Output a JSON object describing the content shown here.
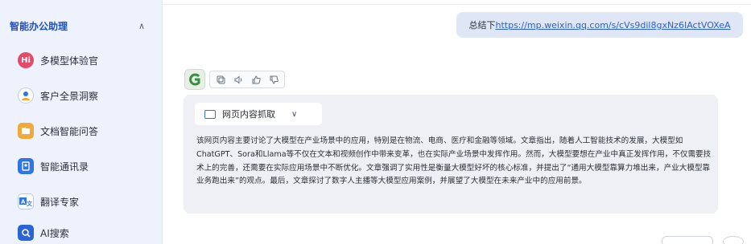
{
  "sidebar": {
    "section_title": "智能办公助理",
    "collapse_glyph": "∧",
    "items": [
      {
        "label": "多模型体验官",
        "icon": "hi-icon",
        "glyph": "Hi"
      },
      {
        "label": "客户全景洞察",
        "icon": "user-insight-icon",
        "glyph": "👤"
      },
      {
        "label": "文档智能问答",
        "icon": "document-icon",
        "glyph": "▬"
      },
      {
        "label": "智能通讯录",
        "icon": "contacts-icon",
        "glyph": "▣"
      },
      {
        "label": "翻译专家",
        "icon": "translate-icon",
        "glyph": "A"
      },
      {
        "label": "AI搜索",
        "icon": "ai-search-icon",
        "glyph": "Q"
      }
    ]
  },
  "chat": {
    "user_message": {
      "prefix": "总结下",
      "link": "https://mp.weixin.qq.com/s/cVs9dil8gxNz6IActVOXeA"
    },
    "tool": {
      "label": "网页内容抓取",
      "chevron": "∨"
    },
    "answer": "该网页内容主要讨论了大模型在产业场景中的应用，特别是在物流、电商、医疗和金融等领域。文章指出，随着人工智能技术的发展，大模型如ChatGPT、Sora和Llama等不仅在文本和视频创作中带来变革，也在实际产业场景中发挥作用。然而，大模型要想在产业中真正发挥作用，不仅需要技术上的完善，还需要在实际应用场景中不断优化。文章强调了实用性是衡量大模型好坏的核心标准，并提出了“通用大模型靠算力堆出来，产业大模型靠业务跑出来”的观点。最后，文章探讨了数字人主播等大模型应用案例，并展望了大模型在未来产业中的应用前景。"
  },
  "colors": {
    "accent": "#1f4fc8",
    "link": "#2a5fd8",
    "user_bubble": "#dfe7f7",
    "answer_bg": "#eef0f5",
    "sidebar_bg": "#eef2fc"
  }
}
